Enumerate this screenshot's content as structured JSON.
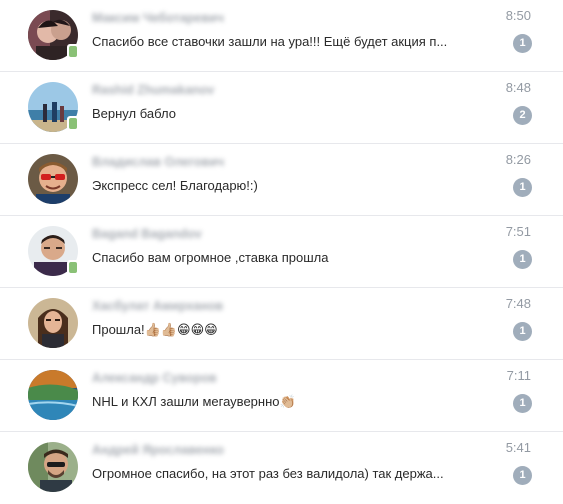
{
  "colors": {
    "unread_badge": "#a0adbb",
    "online_indicator": "#8ac176",
    "time_text": "#939aa3",
    "divider": "#e7e8ec"
  },
  "dialogs": [
    {
      "name": "Максим Чеботаревич",
      "time": "8:50",
      "message": "Спасибо все ставочки зашли на ура!!! Ещё будет акция п...",
      "unread": "1",
      "online_mobile": true,
      "avatar_icon": "user-photo"
    },
    {
      "name": "Rashid Zhumakanov",
      "time": "8:48",
      "message": "Вернул бабло",
      "unread": "2",
      "online_mobile": true,
      "avatar_icon": "user-photo"
    },
    {
      "name": "Владислав Олегович",
      "time": "8:26",
      "message": "Экспресс сел! Благодарю!:)",
      "unread": "1",
      "online_mobile": false,
      "avatar_icon": "user-photo"
    },
    {
      "name": "Bagand Bagandov",
      "time": "7:51",
      "message": "Спасибо вам огромное ,ставка прошла",
      "unread": "1",
      "online_mobile": true,
      "avatar_icon": "user-photo"
    },
    {
      "name": "Хасбулат Амирханов",
      "time": "7:48",
      "message": "Прошла!👍🏼👍🏼😁😁😁",
      "unread": "1",
      "online_mobile": false,
      "avatar_icon": "user-photo"
    },
    {
      "name": "Александр Суворов",
      "time": "7:11",
      "message": "NHL и КХЛ зашли мегаувернно👏🏼",
      "unread": "1",
      "online_mobile": false,
      "avatar_icon": "user-photo"
    },
    {
      "name": "Андрей Ярославенко",
      "time": "5:41",
      "message": "Огромное спасибо, на этот раз без валидола) так держа...",
      "unread": "1",
      "online_mobile": false,
      "avatar_icon": "user-photo"
    }
  ]
}
